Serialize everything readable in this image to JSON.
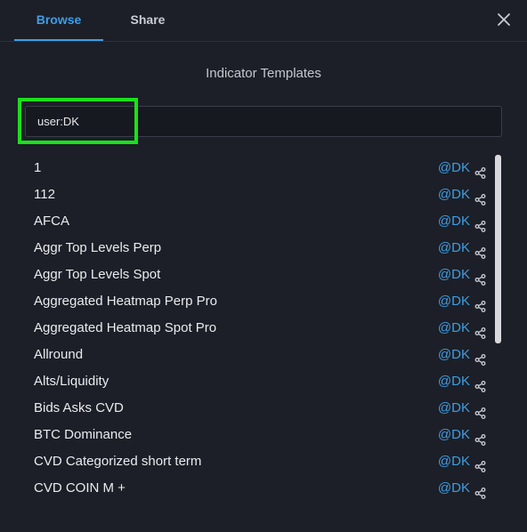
{
  "tabs": [
    {
      "label": "Browse",
      "active": true
    },
    {
      "label": "Share",
      "active": false
    }
  ],
  "dialog": {
    "title": "Indicator Templates",
    "close_icon": "close-icon"
  },
  "search": {
    "value": "user:DK",
    "placeholder": ""
  },
  "templates": [
    {
      "name": "1",
      "author": "@DK"
    },
    {
      "name": "112",
      "author": "@DK"
    },
    {
      "name": "AFCA",
      "author": "@DK"
    },
    {
      "name": "Aggr Top Levels Perp",
      "author": "@DK"
    },
    {
      "name": "Aggr Top Levels Spot",
      "author": "@DK"
    },
    {
      "name": "Aggregated Heatmap Perp Pro",
      "author": "@DK"
    },
    {
      "name": "Aggregated Heatmap Spot Pro",
      "author": "@DK"
    },
    {
      "name": "Allround",
      "author": "@DK"
    },
    {
      "name": "Alts/Liquidity",
      "author": "@DK"
    },
    {
      "name": "Bids Asks CVD",
      "author": "@DK"
    },
    {
      "name": "BTC Dominance",
      "author": "@DK"
    },
    {
      "name": "CVD Categorized short term",
      "author": "@DK"
    },
    {
      "name": "CVD COIN M +",
      "author": "@DK"
    }
  ],
  "colors": {
    "accent": "#3b9ee8",
    "highlight": "#19e11b",
    "background": "#1c1f27"
  }
}
